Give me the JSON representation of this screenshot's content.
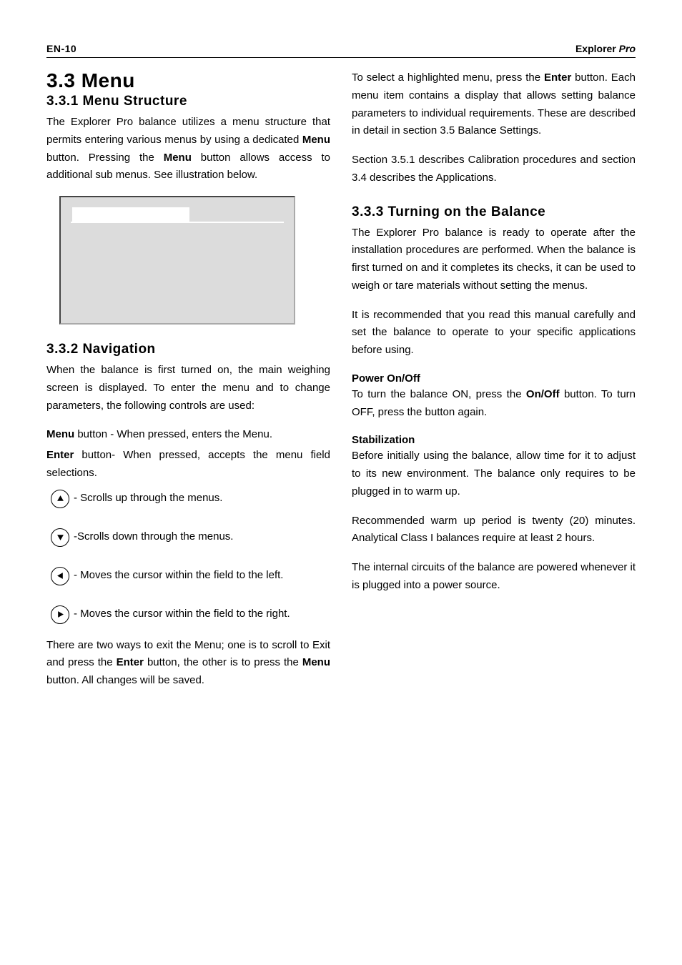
{
  "header": {
    "left": "EN-10",
    "right_plain": "Explorer ",
    "right_italic": "Pro"
  },
  "left_col": {
    "h1": "3.3   Menu",
    "h2_1": "3.3.1   Menu Structure",
    "p1_a": "The Explorer Pro balance utilizes a menu structure that permits entering various menus by using a dedicated ",
    "p1_b": "Menu",
    "p1_c": " button. Pressing the ",
    "p1_d": "Menu",
    "p1_e": " button allows access to additional sub menus.   See illustration below.",
    "h2_2": "3.3.2   Navigation",
    "p2": "When the balance is first turned on, the main weighing screen is displayed.  To enter the menu and to change parameters, the following controls are used:",
    "p3_a": "Menu",
    "p3_b": " button - When pressed, enters the Menu.",
    "p4_a": "Enter",
    "p4_b": " button- When pressed, accepts the menu field selections.",
    "nav_up": " - Scrolls up through the menus.",
    "nav_down": " -Scrolls down through the menus.",
    "nav_left": " - Moves the cursor within the field to the left.",
    "nav_right": " - Moves the cursor within the field to the right.",
    "p5_a": "There are two ways to exit the Menu; one is to scroll to Exit and press the ",
    "p5_b": "Enter",
    "p5_c": " button, the other is to press the ",
    "p5_d": "Menu",
    "p5_e": " button.  All changes will be saved."
  },
  "right_col": {
    "p1_a": "To select a highlighted menu, press the ",
    "p1_b": "Enter",
    "p1_c": " button.  Each menu item contains a display that allows setting balance parameters to individual requirements.  These are described in detail in section 3.5 Balance Settings.",
    "p2": "Section 3.5.1 describes Calibration procedures and section 3.4 describes the Applications.",
    "h2": "3.3.3   Turning on the Balance",
    "p3": "The Explorer Pro balance is ready to operate after the installation procedures are performed. When the balance is first turned on and it completes its checks, it can be used to weigh or tare materials without setting the menus.",
    "p4": "It is recommended that you read this manual carefully and set the balance to operate to your specific applications before using.",
    "sub1": "Power On/Off",
    "p5_a": "To turn the balance ON, press the ",
    "p5_b": "On/Off",
    "p5_c": " button.  To turn OFF, press the button again.",
    "sub2": "Stabilization",
    "p6": "Before initially using the balance, allow time for it to adjust to its new environment. The balance only requires to be plugged in to warm up.",
    "p7": "Recommended warm up period is twenty (20) minutes.  Analytical Class I balances require at least 2 hours.",
    "p8": "The internal circuits of the balance are powered whenever it is plugged into a power source."
  }
}
